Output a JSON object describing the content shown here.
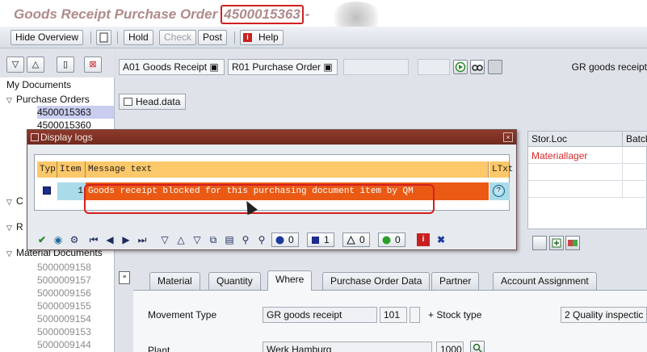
{
  "title": {
    "text": "Goods Receipt Purchase Order",
    "doc_number": "4500015363",
    "separator": "-"
  },
  "toolbar": {
    "hide_overview": "Hide Overview",
    "hold": "Hold",
    "check": "Check",
    "post": "Post",
    "help": "Help"
  },
  "left_nav": {
    "my_documents": "My Documents",
    "purchase_orders": "Purchase Orders",
    "po_items": [
      "4500015363",
      "4500015360"
    ],
    "collapsed_1": "C",
    "collapsed_2": "R",
    "material_documents": "Material Documents",
    "material_items": [
      "5000009158",
      "5000009157",
      "5000009156",
      "5000009155",
      "5000009154",
      "5000009153",
      "5000009144"
    ]
  },
  "header": {
    "action": "A01 Goods Receipt",
    "reference": "R01 Purchase Order",
    "movement_text": "GR goods receipt",
    "head_data": "Head.data"
  },
  "background_grid": {
    "col_stor_loc": "Stor.Loc",
    "col_batch": "Batch",
    "row1_stor_loc": "Materiallager"
  },
  "tabs": [
    {
      "label": "Material"
    },
    {
      "label": "Quantity"
    },
    {
      "label": "Where"
    },
    {
      "label": "Purchase Order Data"
    },
    {
      "label": "Partner"
    },
    {
      "label": "Account Assignment"
    }
  ],
  "detail": {
    "movement_type_label": "Movement Type",
    "movement_type_text": "GR goods receipt",
    "movement_type_code": "101",
    "plus": "+",
    "stock_type_label": "Stock type",
    "stock_type_value": "2 Quality inspectic",
    "plant_label": "Plant",
    "plant_value": "Werk Hamburg",
    "plant_code": "1000"
  },
  "popup": {
    "title": "Display logs",
    "col_typ": "Typ",
    "col_item": "Item",
    "col_message": "Message text",
    "col_ltxt": "LTxt",
    "row_item": "1",
    "row_message": "Goods receipt blocked for this purchasing document item by QM",
    "count_stop": "0",
    "count_info": "1",
    "count_warning": "0",
    "count_success": "0"
  },
  "colors": {
    "title_bar_popup": "#7a2e22",
    "message_highlight": "#ea5a14",
    "header_row": "#fcc86a",
    "annotation_red": "#d42020"
  }
}
